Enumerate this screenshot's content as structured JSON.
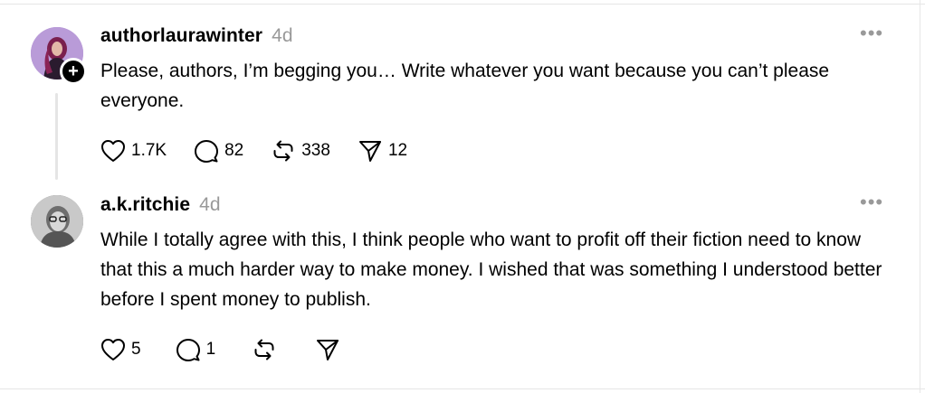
{
  "posts": [
    {
      "username": "authorlaurawinter",
      "time": "4d",
      "more": "•••",
      "text": "Please, authors, I’m begging you… Write whatever you want because you can’t please everyone.",
      "follow_badge": "+",
      "counts": {
        "likes": "1.7K",
        "replies": "82",
        "reposts": "338",
        "shares": "12"
      }
    },
    {
      "username": "a.k.ritchie",
      "time": "4d",
      "more": "•••",
      "text": "While I totally agree with this, I think people who want to profit off their fiction need to know that this a much harder way to make money. I wished that was something I understood better before I spent money to publish.",
      "counts": {
        "likes": "5",
        "replies": "1"
      }
    }
  ],
  "icons": [
    "heart-icon",
    "comment-icon",
    "repost-icon",
    "send-icon"
  ]
}
